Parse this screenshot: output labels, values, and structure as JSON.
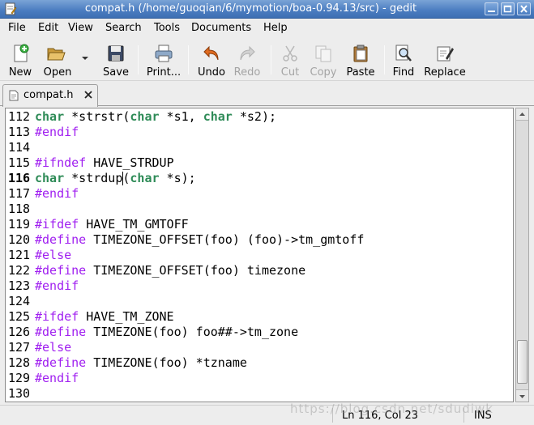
{
  "window": {
    "title": "compat.h (/home/guoqian/6/mymotion/boa-0.94.13/src) - gedit"
  },
  "menu": [
    "File",
    "Edit",
    "View",
    "Search",
    "Tools",
    "Documents",
    "Help"
  ],
  "toolbar": {
    "new": "New",
    "open": "Open",
    "save": "Save",
    "print": "Print...",
    "undo": "Undo",
    "redo": "Redo",
    "cut": "Cut",
    "copy": "Copy",
    "paste": "Paste",
    "find": "Find",
    "replace": "Replace"
  },
  "tab": {
    "label": "compat.h"
  },
  "editor": {
    "current_line": "116",
    "lines": [
      {
        "n": "112",
        "text": "char *strstr(char *s1, char *s2);"
      },
      {
        "n": "113",
        "text": "#endif"
      },
      {
        "n": "114",
        "text": ""
      },
      {
        "n": "115",
        "text": "#ifndef HAVE_STRDUP"
      },
      {
        "n": "116",
        "text": "char *strdup(char *s);"
      },
      {
        "n": "117",
        "text": "#endif"
      },
      {
        "n": "118",
        "text": ""
      },
      {
        "n": "119",
        "text": "#ifdef HAVE_TM_GMTOFF"
      },
      {
        "n": "120",
        "text": "#define TIMEZONE_OFFSET(foo) (foo)->tm_gmtoff"
      },
      {
        "n": "121",
        "text": "#else"
      },
      {
        "n": "122",
        "text": "#define TIMEZONE_OFFSET(foo) timezone"
      },
      {
        "n": "123",
        "text": "#endif"
      },
      {
        "n": "124",
        "text": ""
      },
      {
        "n": "125",
        "text": "#ifdef HAVE_TM_ZONE"
      },
      {
        "n": "126",
        "text": "#define TIMEZONE(foo) foo##->tm_zone"
      },
      {
        "n": "127",
        "text": "#else"
      },
      {
        "n": "128",
        "text": "#define TIMEZONE(foo) *tzname"
      },
      {
        "n": "129",
        "text": "#endif"
      },
      {
        "n": "130",
        "text": ""
      }
    ]
  },
  "status": {
    "position": "Ln 116, Col 23",
    "mode": "INS"
  },
  "watermark": "https://blog.csdn.net/sdudiwk",
  "colors": {
    "keyword": "#2e8b57",
    "preprocessor": "#a020f0",
    "titlebar": "#4a7cc0"
  }
}
